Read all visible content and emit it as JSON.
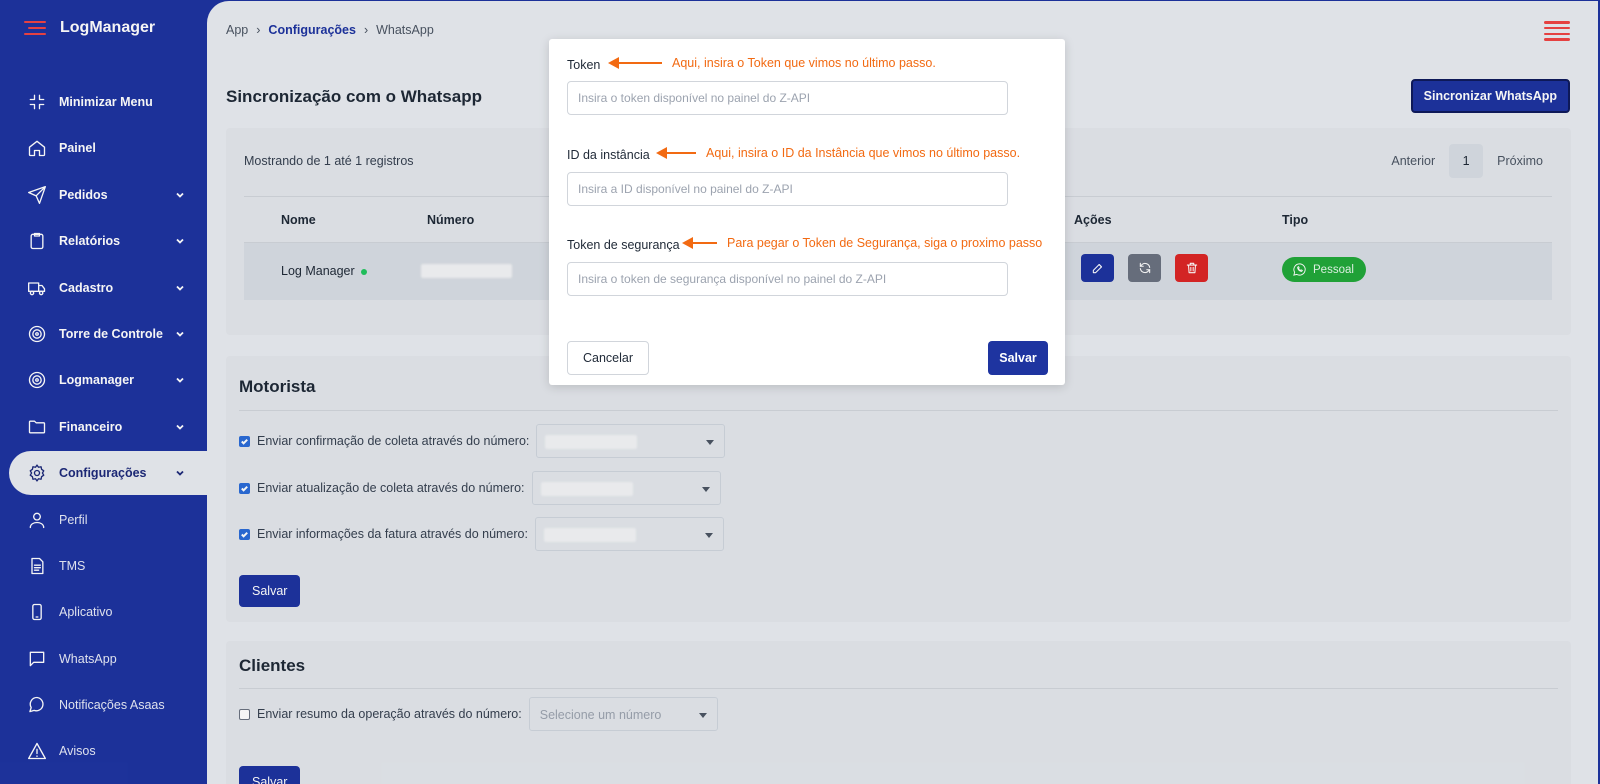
{
  "brand": {
    "name": "LogManager"
  },
  "sidebar": {
    "items": [
      {
        "label": "Minimizar Menu",
        "icon": "minimize-icon",
        "chevron": false
      },
      {
        "label": "Painel",
        "icon": "home-icon",
        "chevron": false
      },
      {
        "label": "Pedidos",
        "icon": "send-icon",
        "chevron": true
      },
      {
        "label": "Relatórios",
        "icon": "clipboard-icon",
        "chevron": true
      },
      {
        "label": "Cadastro",
        "icon": "truck-icon",
        "chevron": true
      },
      {
        "label": "Torre de Controle",
        "icon": "target-icon",
        "chevron": true
      },
      {
        "label": "Logmanager",
        "icon": "target-icon",
        "chevron": true
      },
      {
        "label": "Financeiro",
        "icon": "folder-icon",
        "chevron": true
      },
      {
        "label": "Configurações",
        "icon": "gear-icon",
        "chevron": true,
        "active": true
      },
      {
        "label": "Perfil",
        "icon": "user-icon",
        "chevron": false
      },
      {
        "label": "TMS",
        "icon": "document-icon",
        "chevron": false
      },
      {
        "label": "Aplicativo",
        "icon": "phone-icon",
        "chevron": false
      },
      {
        "label": "WhatsApp",
        "icon": "chat-icon",
        "chevron": false
      },
      {
        "label": "Notificações Asaas",
        "icon": "chat-bubble-icon",
        "chevron": false
      },
      {
        "label": "Avisos",
        "icon": "warning-icon",
        "chevron": false
      }
    ]
  },
  "breadcrumb": {
    "root": "App",
    "parent": "Configurações",
    "current": "WhatsApp"
  },
  "page": {
    "title": "Sincronização com o Whatsapp",
    "sync_button": "Sincronizar WhatsApp"
  },
  "table": {
    "showing": "Mostrando de 1 até 1 registros",
    "pager": {
      "prev": "Anterior",
      "page": "1",
      "next": "Próximo"
    },
    "columns": {
      "name": "Nome",
      "number": "Número",
      "actions": "Ações",
      "type": "Tipo"
    },
    "rows": [
      {
        "name": "Log Manager",
        "type": "Pessoal"
      }
    ]
  },
  "motorista": {
    "title": "Motorista",
    "options": [
      {
        "label": "Enviar confirmação de coleta através do número:",
        "checked": true
      },
      {
        "label": "Enviar atualização de coleta através do número:",
        "checked": true
      },
      {
        "label": "Enviar informações da fatura através do número:",
        "checked": true
      }
    ],
    "save": "Salvar"
  },
  "clientes": {
    "title": "Clientes",
    "option": {
      "label": "Enviar resumo da operação através do número:",
      "checked": false,
      "placeholder": "Selecione um número"
    },
    "save": "Salvar"
  },
  "modal": {
    "token_label": "Token",
    "token_placeholder": "Insira o token disponível no painel do Z-API",
    "token_note": "Aqui, insira o Token que vimos no último passo.",
    "instance_label": "ID da instância",
    "instance_placeholder": "Insira a ID disponível no painel do Z-API",
    "instance_note": "Aqui, insira o ID da Instância que vimos no último passo.",
    "security_label": "Token de segurança",
    "security_placeholder": "Insira o token de segurança disponível no painel do Z-API",
    "security_note": "Para pegar o Token de Segurança, siga o proximo passo",
    "cancel": "Cancelar",
    "save": "Salvar"
  },
  "colors": {
    "primary": "#1e34a0",
    "annotation": "#f26a12",
    "success": "#22a83a",
    "danger": "#dc2626",
    "neutral": "#6b7280"
  }
}
